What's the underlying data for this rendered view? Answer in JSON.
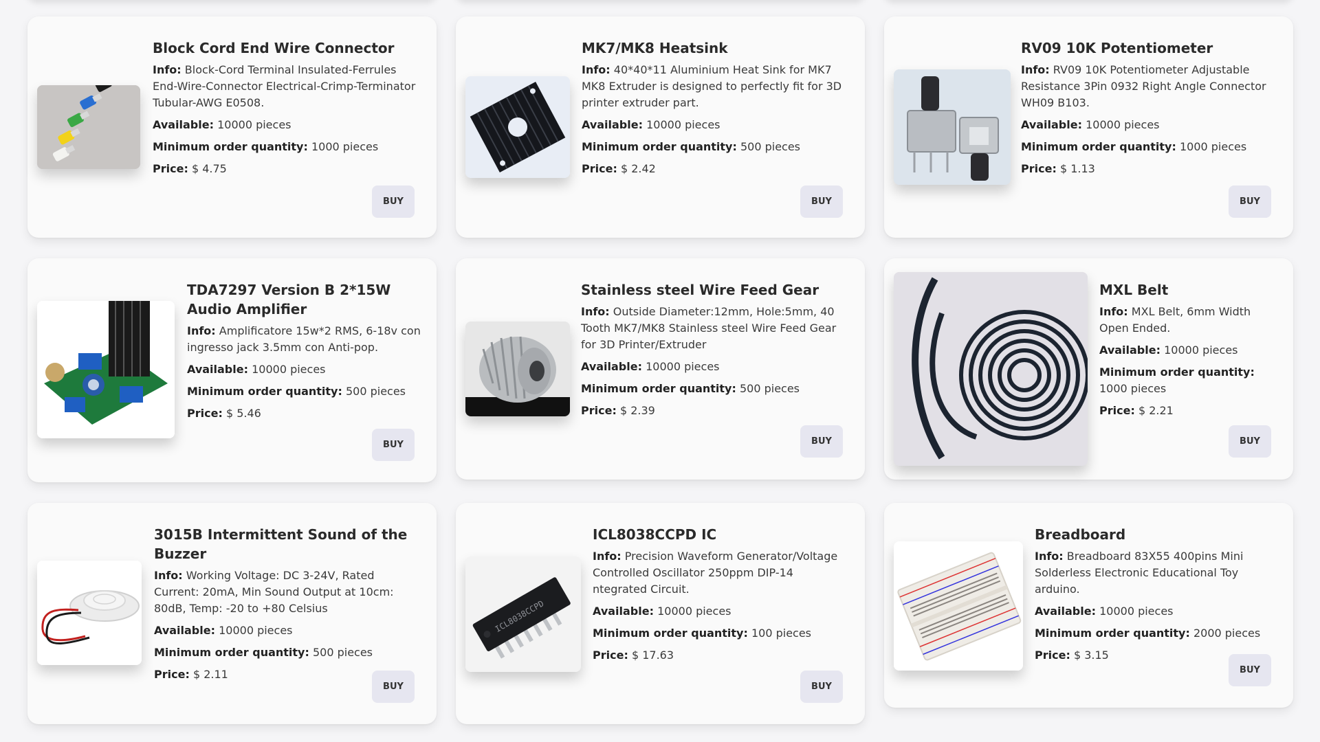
{
  "labels": {
    "info": "Info:",
    "available": "Available:",
    "min_order": "Minimum order quantity:",
    "price": "Price:"
  },
  "products": [
    {
      "title": "Block Cord End Wire Connector",
      "info": "Block-Cord Terminal Insulated-Ferrules End-Wire-Connector Electrical-Crimp-Terminator Tubular-AWG E0508.",
      "available": "10000 pieces",
      "min_order": "1000 pieces",
      "price": "$ 4.75",
      "buy_label": "BUY",
      "image_icon": "wire-ferrules-image"
    },
    {
      "title": "MK7/MK8 Heatsink",
      "info": "40*40*11 Aluminium Heat Sink for MK7 MK8 Extruder is designed to perfectly fit for 3D printer extruder part.",
      "available": "10000 pieces",
      "min_order": "500 pieces",
      "price": "$ 2.42",
      "buy_label": "BUY",
      "image_icon": "heatsink-image"
    },
    {
      "title": "RV09 10K Potentiometer",
      "info": "RV09 10K Potentiometer Adjustable Resistance 3Pin 0932 Right Angle Connector WH09 B103.",
      "available": "10000 pieces",
      "min_order": "1000 pieces",
      "price": "$ 1.13",
      "buy_label": "BUY",
      "image_icon": "potentiometer-image"
    },
    {
      "title": "TDA7297 Version B 2*15W Audio Amplifier",
      "info": "Amplificatore 15w*2 RMS, 6-18v con ingresso jack 3.5mm con Anti-pop.",
      "available": "10000 pieces",
      "min_order": "500 pieces",
      "price": "$ 5.46",
      "buy_label": "BUY",
      "image_icon": "amplifier-board-image"
    },
    {
      "title": "Stainless steel Wire Feed Gear",
      "info": "Outside Diameter:12mm, Hole:5mm, 40 Tooth MK7/MK8 Stainless steel Wire Feed Gear for 3D Printer/Extruder",
      "available": "10000 pieces",
      "min_order": "500 pieces",
      "price": "$ 2.39",
      "buy_label": "BUY",
      "image_icon": "feed-gear-image"
    },
    {
      "title": "MXL Belt",
      "info": "MXL Belt, 6mm Width Open Ended.",
      "available": "10000 pieces",
      "min_order": "1000 pieces",
      "price": "$ 2.21",
      "buy_label": "BUY",
      "image_icon": "timing-belt-image"
    },
    {
      "title": "3015B Intermittent Sound of the Buzzer",
      "info": "Working Voltage: DC 3-24V, Rated Current: 20mA, Min Sound Output at 10cm: 80dB, Temp: -20 to +80 Celsius",
      "available": "10000 pieces",
      "min_order": "500 pieces",
      "price": "$ 2.11",
      "buy_label": "BUY",
      "image_icon": "buzzer-image"
    },
    {
      "title": "ICL8038CCPD IC",
      "info": "Precision Waveform Generator/Voltage Controlled Oscillator 250ppm DIP-14 ntegrated Circuit.",
      "available": "10000 pieces",
      "min_order": "100 pieces",
      "price": "$ 17.63",
      "buy_label": "BUY",
      "image_icon": "dip-ic-chip-image",
      "chip_marking": "ICL8038CCPD"
    },
    {
      "title": "Breadboard",
      "info": "Breadboard 83X55 400pins Mini Solderless Electronic Educational Toy arduino.",
      "available": "10000 pieces",
      "min_order": "2000 pieces",
      "price": "$ 3.15",
      "buy_label": "BUY",
      "image_icon": "breadboard-image"
    }
  ]
}
